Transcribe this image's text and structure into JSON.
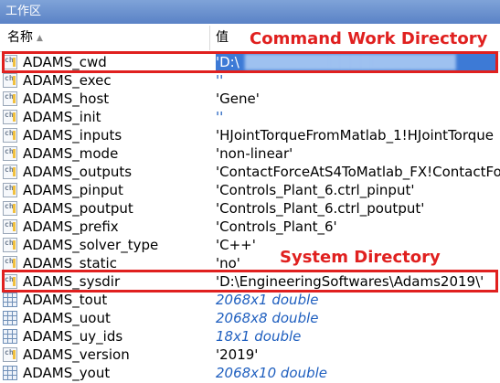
{
  "window": {
    "title": "工作区"
  },
  "columns": {
    "name": "名称",
    "value": "值"
  },
  "annotations": {
    "cwd_label": "Command Work Directory",
    "sysdir_label": "System Directory",
    "highlight_color": "#e0201f"
  },
  "rows": [
    {
      "icon": "char-array-icon",
      "name": "ADAMS_cwd",
      "value": "'D:\\",
      "value_type": "redacted"
    },
    {
      "icon": "char-array-icon",
      "name": "ADAMS_exec",
      "value": "''",
      "value_type": "empty"
    },
    {
      "icon": "char-array-icon",
      "name": "ADAMS_host",
      "value": "'Gene'",
      "value_type": "char"
    },
    {
      "icon": "char-array-icon",
      "name": "ADAMS_init",
      "value": "''",
      "value_type": "empty"
    },
    {
      "icon": "char-array-icon",
      "name": "ADAMS_inputs",
      "value": "'HJointTorqueFromMatlab_1!HJointTorque",
      "value_type": "char"
    },
    {
      "icon": "char-array-icon",
      "name": "ADAMS_mode",
      "value": "'non-linear'",
      "value_type": "char"
    },
    {
      "icon": "char-array-icon",
      "name": "ADAMS_outputs",
      "value": "'ContactForceAtS4ToMatlab_FX!ContactFo",
      "value_type": "char"
    },
    {
      "icon": "char-array-icon",
      "name": "ADAMS_pinput",
      "value": "'Controls_Plant_6.ctrl_pinput'",
      "value_type": "char"
    },
    {
      "icon": "char-array-icon",
      "name": "ADAMS_poutput",
      "value": "'Controls_Plant_6.ctrl_poutput'",
      "value_type": "char"
    },
    {
      "icon": "char-array-icon",
      "name": "ADAMS_prefix",
      "value": "'Controls_Plant_6'",
      "value_type": "char"
    },
    {
      "icon": "char-array-icon",
      "name": "ADAMS_solver_type",
      "value": "'C++'",
      "value_type": "char"
    },
    {
      "icon": "char-array-icon",
      "name": "ADAMS_static",
      "value": "'no'",
      "value_type": "char"
    },
    {
      "icon": "char-array-icon",
      "name": "ADAMS_sysdir",
      "value": "'D:\\EngineeringSoftwares\\Adams2019\\'",
      "value_type": "char"
    },
    {
      "icon": "matrix-icon",
      "name": "ADAMS_tout",
      "value": "2068x1 double",
      "value_type": "numeric"
    },
    {
      "icon": "matrix-icon",
      "name": "ADAMS_uout",
      "value": "2068x8 double",
      "value_type": "numeric"
    },
    {
      "icon": "matrix-icon",
      "name": "ADAMS_uy_ids",
      "value": "18x1 double",
      "value_type": "numeric"
    },
    {
      "icon": "char-array-icon",
      "name": "ADAMS_version",
      "value": "'2019'",
      "value_type": "char"
    },
    {
      "icon": "matrix-icon",
      "name": "ADAMS_yout",
      "value": "2068x10 double",
      "value_type": "numeric"
    }
  ]
}
